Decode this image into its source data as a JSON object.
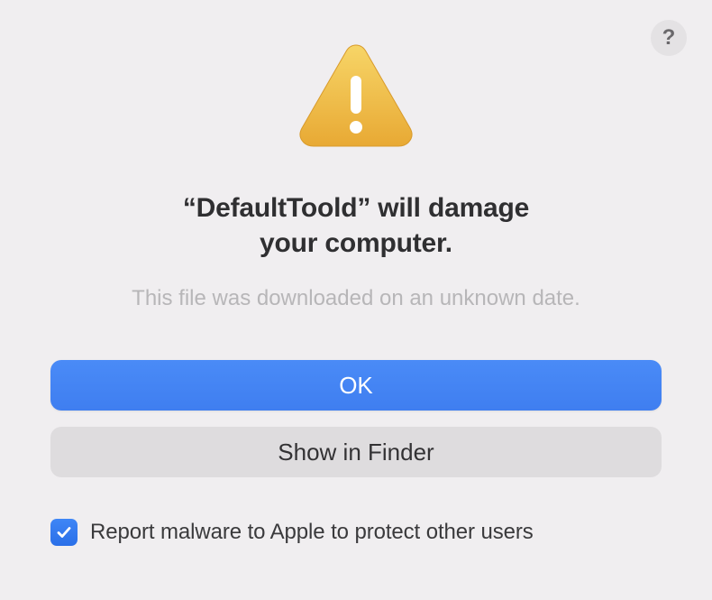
{
  "dialog": {
    "help_label": "?",
    "app_name": "DefaultToold",
    "title": "“DefaultToold” will damage\nyour computer.",
    "subtitle": "This file was downloaded on an unknown date.",
    "buttons": {
      "primary": "OK",
      "secondary": "Show in Finder"
    },
    "checkbox": {
      "checked": true,
      "label": "Report malware to Apple to protect other users"
    }
  },
  "colors": {
    "primary_button": "#4a8bf7",
    "secondary_button": "#dedcde",
    "checkbox": "#3f86f6",
    "background": "#f0eef0"
  }
}
